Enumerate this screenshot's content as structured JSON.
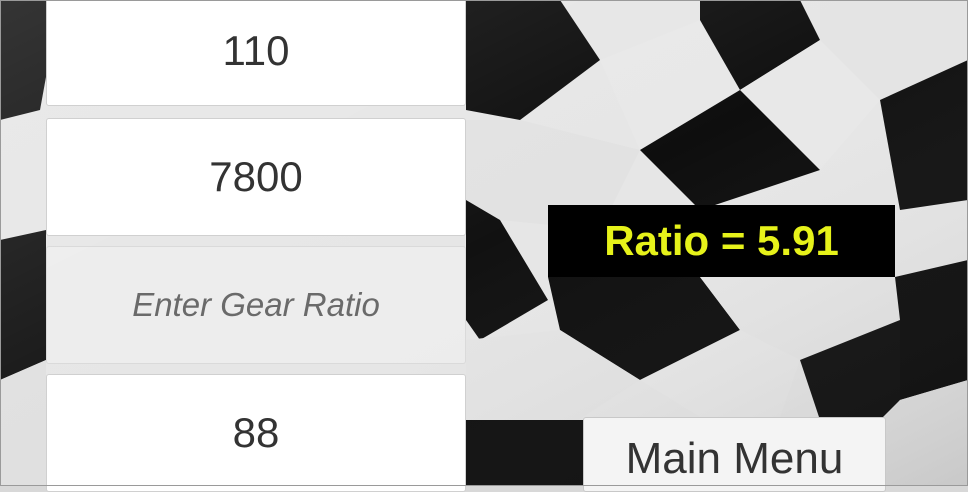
{
  "background": {
    "image": "checkered-flag",
    "colors": {
      "dark": "#000000",
      "light": "#e8e8e8"
    }
  },
  "fields": {
    "field_1_value": "110",
    "field_2_value": "7800",
    "field_3_placeholder": "Enter Gear Ratio",
    "field_4_value": "88"
  },
  "result": {
    "text": "Ratio = 5.91",
    "text_color": "#e6f21a",
    "background": "#000000"
  },
  "buttons": {
    "main_menu_label": "Main Menu"
  }
}
